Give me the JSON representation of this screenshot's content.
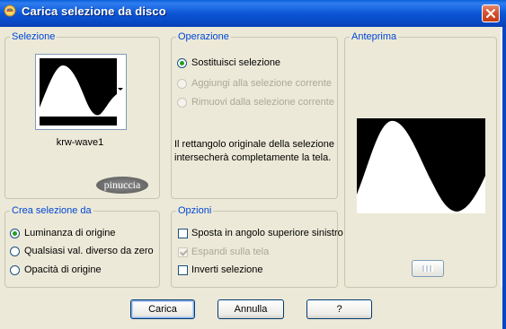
{
  "window": {
    "title": "Carica selezione da disco"
  },
  "selezione": {
    "legend": "Selezione",
    "selected_name": "krw-wave1",
    "stamp_text": "pinuccia"
  },
  "operazione": {
    "legend": "Operazione",
    "options": [
      {
        "label": "Sostituisci selezione",
        "checked": true,
        "enabled": true
      },
      {
        "label": "Aggiungi alla selezione corrente",
        "checked": false,
        "enabled": false
      },
      {
        "label": "Rimuovi dalla selezione corrente",
        "checked": false,
        "enabled": false
      }
    ],
    "info_line1": "Il rettangolo originale della selezione",
    "info_line2": "intersecherà completamente la tela."
  },
  "anteprima": {
    "legend": "Anteprima"
  },
  "crea_selezione": {
    "legend": "Crea selezione da",
    "options": [
      {
        "label": "Luminanza di origine",
        "checked": true
      },
      {
        "label": "Qualsiasi val. diverso da zero",
        "checked": false
      },
      {
        "label": "Opacità di origine",
        "checked": false
      }
    ]
  },
  "opzioni": {
    "legend": "Opzioni",
    "items": [
      {
        "label": "Sposta in angolo superiore sinistro",
        "checked": false,
        "enabled": true
      },
      {
        "label": "Espandi sulla tela",
        "checked": true,
        "enabled": false
      },
      {
        "label": "Inverti selezione",
        "checked": false,
        "enabled": true
      }
    ]
  },
  "buttons": {
    "carica": "Carica",
    "annulla": "Annulla",
    "help": "?"
  },
  "icons": {
    "app": "app-icon",
    "close": "close-icon",
    "dropdown": "chevron-down-icon",
    "preview_toggle": "preview-toggle-icon"
  },
  "colors": {
    "title_bar": "#0b56d5",
    "dialog_bg": "#ece9d8",
    "legend_text": "#0046d5",
    "close_button": "#d5532f",
    "radio_dot": "#21a121"
  }
}
